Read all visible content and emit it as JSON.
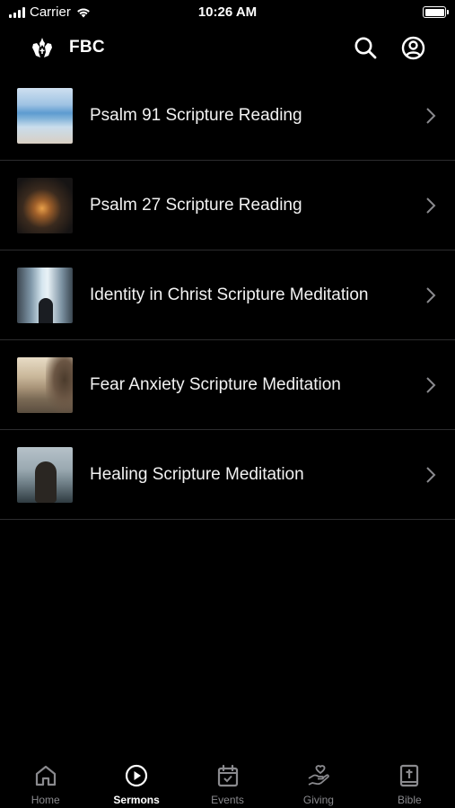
{
  "status_bar": {
    "carrier": "Carrier",
    "time": "10:26 AM"
  },
  "header": {
    "title": "FBC",
    "logo_icon": "church-hands-logo-icon",
    "search_icon": "search-icon",
    "account_icon": "account-circle-icon"
  },
  "sermons": [
    {
      "title": "Psalm 91 Scripture Reading",
      "thumbnail": "ocean-horizon-image"
    },
    {
      "title": "Psalm 27 Scripture Reading",
      "thumbnail": "sunset-lake-image"
    },
    {
      "title": "Identity in Christ Scripture Meditation",
      "thumbnail": "waterfall-person-image"
    },
    {
      "title": "Fear Anxiety Scripture Meditation",
      "thumbnail": "woman-seaside-image"
    },
    {
      "title": "Healing Scripture Meditation",
      "thumbnail": "woman-lake-portrait-image"
    }
  ],
  "tabs": [
    {
      "label": "Home",
      "icon": "home-icon",
      "active": false
    },
    {
      "label": "Sermons",
      "icon": "play-circle-icon",
      "active": true
    },
    {
      "label": "Events",
      "icon": "calendar-check-icon",
      "active": false
    },
    {
      "label": "Giving",
      "icon": "hand-heart-icon",
      "active": false
    },
    {
      "label": "Bible",
      "icon": "bible-cross-icon",
      "active": false
    }
  ],
  "colors": {
    "background": "#000000",
    "divider": "#2c2c2e",
    "tab_inactive": "#8a8a8e",
    "tab_active": "#ffffff"
  }
}
